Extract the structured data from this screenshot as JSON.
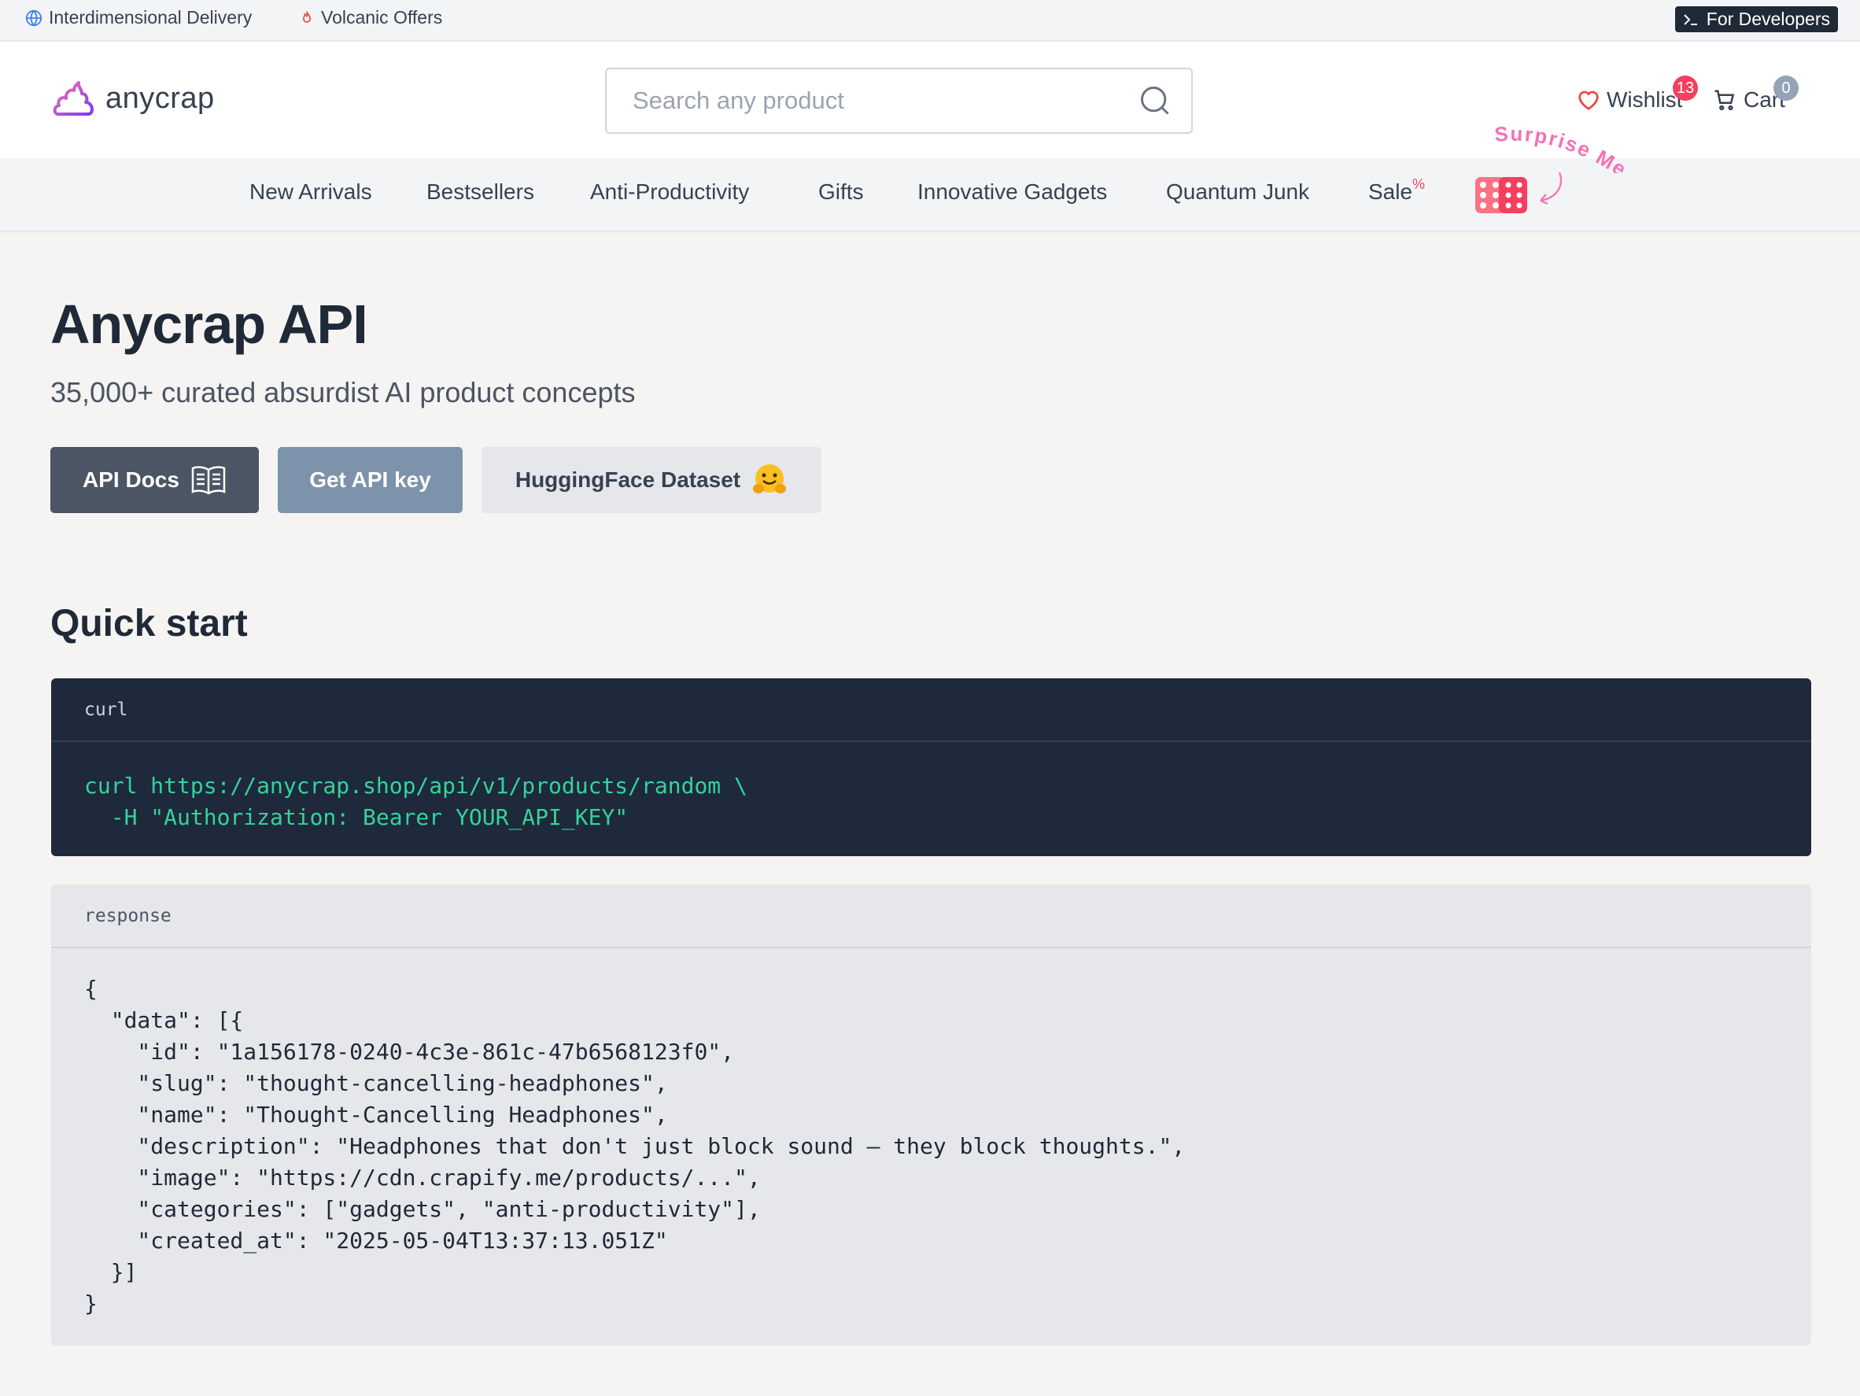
{
  "topbar": {
    "delivery": "Interdimensional Delivery",
    "offers": "Volcanic Offers",
    "developers": "For Developers"
  },
  "header": {
    "logo_text": "anycrap",
    "search_placeholder": "Search any product",
    "wishlist_label": "Wishlist",
    "wishlist_count": "13",
    "cart_label": "Cart",
    "cart_count": "0"
  },
  "nav": {
    "items": [
      "New Arrivals",
      "Bestsellers",
      "Anti-Productivity",
      "Gifts",
      "Innovative Gadgets",
      "Quantum Junk",
      "Sale"
    ],
    "sale_mark": "%",
    "surprise": "Surprise Me"
  },
  "hero": {
    "title": "Anycrap API",
    "subtitle": "35,000+ curated absurdist AI product concepts",
    "buttons": {
      "docs": "API Docs",
      "key": "Get API key",
      "dataset": "HuggingFace Dataset"
    }
  },
  "quickstart": {
    "heading": "Quick start",
    "curl_label": "curl",
    "curl_code": "curl https://anycrap.shop/api/v1/products/random \\\n  -H \"Authorization: Bearer YOUR_API_KEY\"",
    "response_label": "response",
    "response_code": "{\n  \"data\": [{\n    \"id\": \"1a156178-0240-4c3e-861c-47b6568123f0\",\n    \"slug\": \"thought-cancelling-headphones\",\n    \"name\": \"Thought-Cancelling Headphones\",\n    \"description\": \"Headphones that don't just block sound – they block thoughts.\",\n    \"image\": \"https://cdn.crapify.me/products/...\",\n    \"categories\": [\"gadgets\", \"anti-productivity\"],\n    \"created_at\": \"2025-05-04T13:37:13.051Z\"\n  }]\n}"
  },
  "colors": {
    "accent_red": "#f43f5e",
    "code_bg": "#1e293b",
    "code_text": "#34d399",
    "docs_button": "#4b5563",
    "key_button": "#7c93ab"
  }
}
